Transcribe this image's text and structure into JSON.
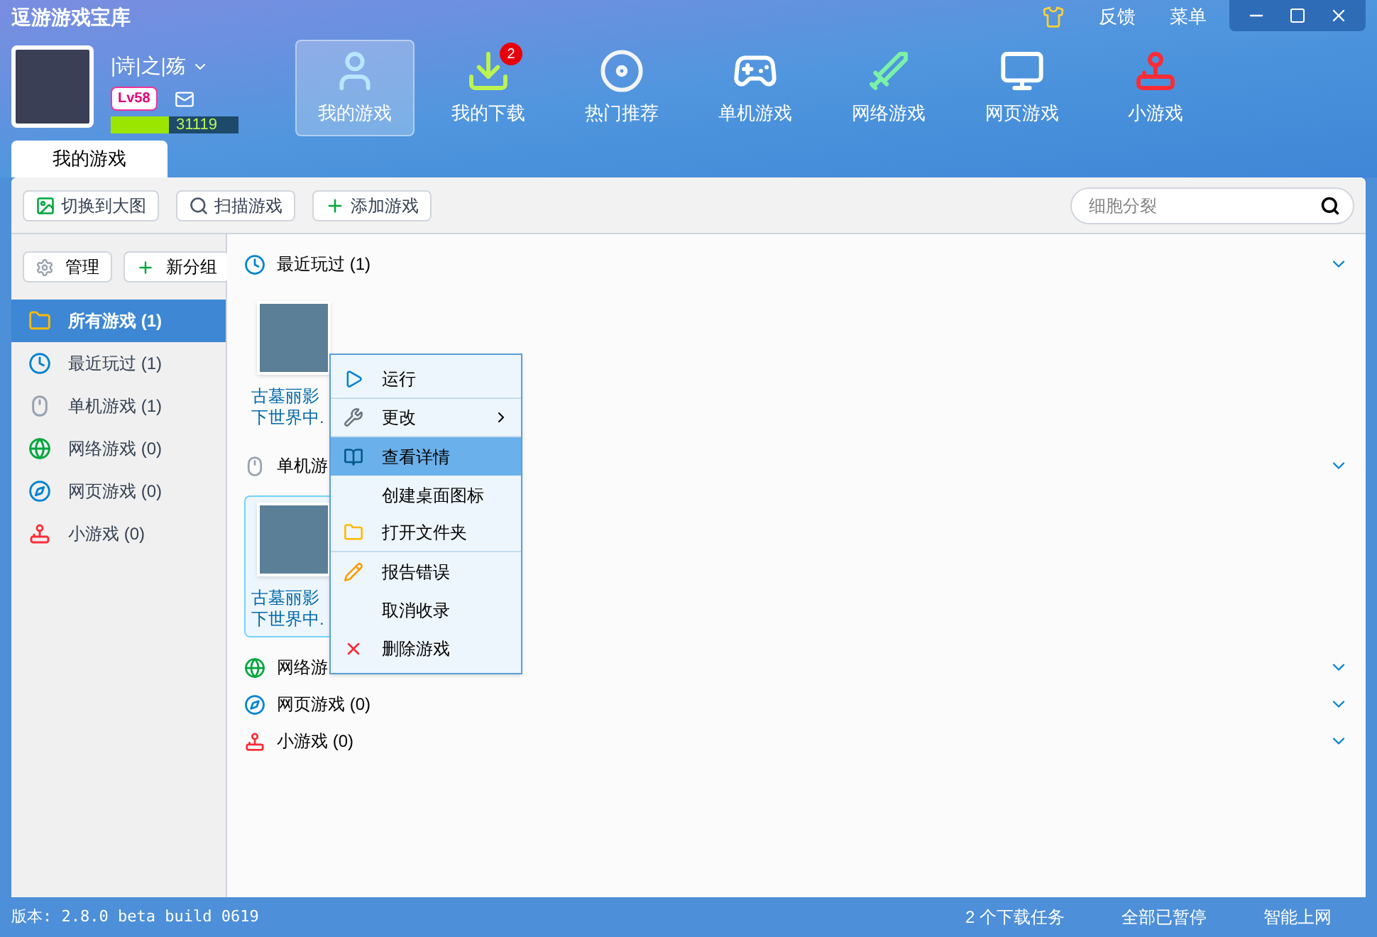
{
  "window": {
    "title": "逗游游戏宝库",
    "links": [
      "反馈",
      "菜单"
    ]
  },
  "user": {
    "name": "|诗|之|殇",
    "level_badge": "Lv58",
    "exp": {
      "level": 0.45,
      "reading": "31119"
    }
  },
  "nav": [
    {
      "label": "我的游戏",
      "kind": "user",
      "selected": true
    },
    {
      "label": "我的下载",
      "kind": "download",
      "selected": false,
      "badge": "2"
    },
    {
      "label": "热门推荐",
      "kind": "disc",
      "selected": false
    },
    {
      "label": "单机游戏",
      "kind": "gamepad",
      "selected": false
    },
    {
      "label": "网络游戏",
      "kind": "sword",
      "selected": false
    },
    {
      "label": "网页游戏",
      "kind": "monitor",
      "selected": false
    },
    {
      "label": "小游戏",
      "kind": "joystick",
      "selected": false
    }
  ],
  "tab": {
    "label": "我的游戏"
  },
  "toolbar": {
    "buttons": [
      {
        "label": "切换到大图",
        "kind": "image"
      },
      {
        "label": "扫描游戏",
        "kind": "search"
      },
      {
        "label": "添加游戏",
        "kind": "plus"
      }
    ],
    "search": {
      "placeholder": "细胞分裂"
    }
  },
  "sidebar": {
    "buttons": [
      {
        "label": "管理",
        "kind": "gear"
      },
      {
        "label": "新分组",
        "kind": "plus"
      }
    ],
    "items": [
      {
        "label": "所有游戏 (1)",
        "kind": "folder",
        "selected": true
      },
      {
        "label": "最近玩过 (1)",
        "kind": "clock",
        "selected": false
      },
      {
        "label": "单机游戏 (1)",
        "kind": "mouse",
        "selected": false
      },
      {
        "label": "网络游戏 (0)",
        "kind": "globe",
        "selected": false
      },
      {
        "label": "网页游戏 (0)",
        "kind": "browser",
        "selected": false
      },
      {
        "label": "小游戏 (0)",
        "kind": "joystick",
        "selected": false
      }
    ]
  },
  "sections": [
    {
      "title": "最近玩过 (1)",
      "kind": "clock",
      "games": [
        {
          "title_lines": [
            "古墓丽影",
            "下世界中."
          ],
          "selected": false
        }
      ]
    },
    {
      "title": "单机游",
      "kind": "mouse",
      "games": [
        {
          "title_lines": [
            "古墓丽影",
            "下世界中."
          ],
          "selected": true
        }
      ]
    },
    {
      "title": "网络游",
      "kind": "globe"
    },
    {
      "title": "网页游戏 (0)",
      "kind": "browser"
    },
    {
      "title": "小游戏 (0)",
      "kind": "joystick"
    }
  ],
  "context_menu": [
    {
      "label": "运行",
      "kind": "play",
      "selected": false,
      "separator_after": true,
      "submenu": false
    },
    {
      "label": "更改",
      "kind": "wrench",
      "selected": false,
      "separator_after": true,
      "submenu": true
    },
    {
      "label": "查看详情",
      "kind": "book",
      "selected": true,
      "separator_after": false,
      "submenu": false
    },
    {
      "label": "创建桌面图标",
      "kind": "none",
      "selected": false,
      "separator_after": false,
      "submenu": false
    },
    {
      "label": "打开文件夹",
      "kind": "folder",
      "selected": false,
      "separator_after": true,
      "submenu": false
    },
    {
      "label": "报告错误",
      "kind": "pencil",
      "selected": false,
      "separator_after": false,
      "submenu": false
    },
    {
      "label": "取消收录",
      "kind": "none",
      "selected": false,
      "separator_after": false,
      "submenu": false
    },
    {
      "label": "删除游戏",
      "kind": "delete",
      "selected": false,
      "separator_after": false,
      "submenu": false
    }
  ],
  "status_bar": {
    "version": "版本: 2.8.0 beta build 0619",
    "items": [
      "2 个下载任务",
      "全部已暂停",
      "智能上网"
    ]
  }
}
